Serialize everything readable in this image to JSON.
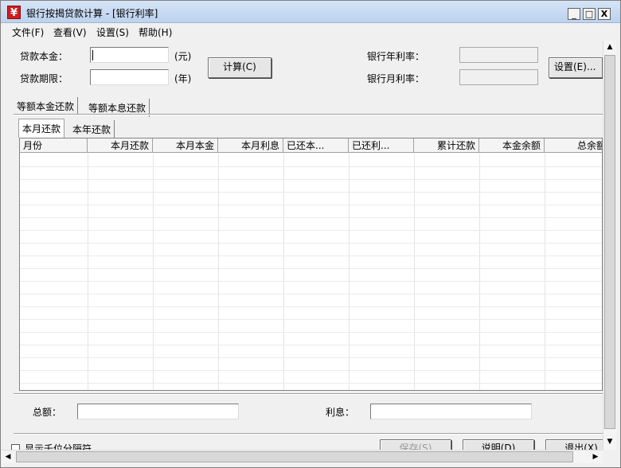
{
  "window": {
    "title": "银行按揭贷款计算  - [银行利率]",
    "icon": "¥",
    "controls": {
      "minimize": "_",
      "maximize": "□",
      "close": "X"
    }
  },
  "menu": [
    "文件(F)",
    "查看(V)",
    "设置(S)",
    "帮助(H)"
  ],
  "inputs": {
    "principal_label": "贷款本金：",
    "principal_value": "",
    "principal_unit": "(元)",
    "term_label": "贷款期限：",
    "term_value": "",
    "term_unit": "(年)",
    "calc_button": "计算(C)",
    "annual_rate_label": "银行年利率：",
    "annual_rate_value": "",
    "monthly_rate_label": "银行月利率：",
    "monthly_rate_value": "",
    "settings_button": "设置(E)..."
  },
  "outer_tabs": [
    "等额本金还款",
    "等额本息还款"
  ],
  "inner_tabs": [
    "本月还款",
    "本年还款"
  ],
  "grid": {
    "columns": [
      "月份",
      "本月还款",
      "本月本金",
      "本月利息",
      "已还本...",
      "已还利...",
      "累计还款",
      "本金余额",
      "总余额"
    ],
    "rows": []
  },
  "totals": {
    "total_label": "总额：",
    "total_value": "",
    "interest_label": "利息：",
    "interest_value": ""
  },
  "footer": {
    "checkbox_label": "显示千位分隔符",
    "save_button": "保存(S)",
    "help_button": "说明(D)",
    "exit_button": "退出(X)"
  },
  "colors": {
    "titlebar": "#c8daf2",
    "icon_red": "#d01c1c",
    "window_bg": "#f0f0f0"
  }
}
